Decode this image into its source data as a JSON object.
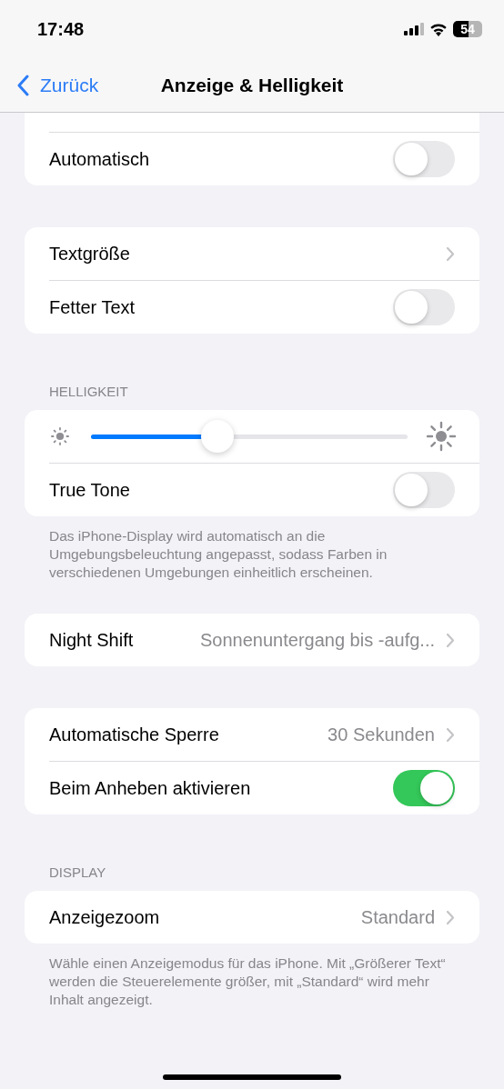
{
  "status_bar": {
    "time": "17:48",
    "battery": "54"
  },
  "nav": {
    "back": "Zurück",
    "title": "Anzeige & Helligkeit"
  },
  "sections": [
    {
      "rows": [
        {
          "kind": "toggle",
          "label": "Automatisch",
          "on": false
        }
      ]
    },
    {
      "rows": [
        {
          "kind": "link",
          "label": "Textgröße"
        },
        {
          "kind": "toggle",
          "label": "Fetter Text",
          "on": false
        }
      ]
    },
    {
      "header": "HELLIGKEIT",
      "rows": [
        {
          "kind": "slider",
          "level": 0.4
        },
        {
          "kind": "toggle",
          "label": "True Tone",
          "on": false
        }
      ],
      "footer": "Das iPhone-Display wird automatisch an die Umgebungsbeleuchtung angepasst, sodass Farben in verschiedenen Umgebungen einheitlich erscheinen."
    },
    {
      "rows": [
        {
          "kind": "link",
          "label": "Night Shift",
          "value": "Sonnenuntergang bis -aufg..."
        }
      ]
    },
    {
      "rows": [
        {
          "kind": "link",
          "label": "Automatische Sperre",
          "value": "30 Sekunden"
        },
        {
          "kind": "toggle",
          "label": "Beim Anheben aktivieren",
          "on": true
        }
      ]
    },
    {
      "header": "DISPLAY",
      "rows": [
        {
          "kind": "link",
          "label": "Anzeigezoom",
          "value": "Standard"
        }
      ],
      "footer": "Wähle einen Anzeigemodus für das iPhone. Mit „Größerer Text“ werden die Steuerelemente größer, mit „Standard“ wird mehr Inhalt angezeigt."
    }
  ]
}
